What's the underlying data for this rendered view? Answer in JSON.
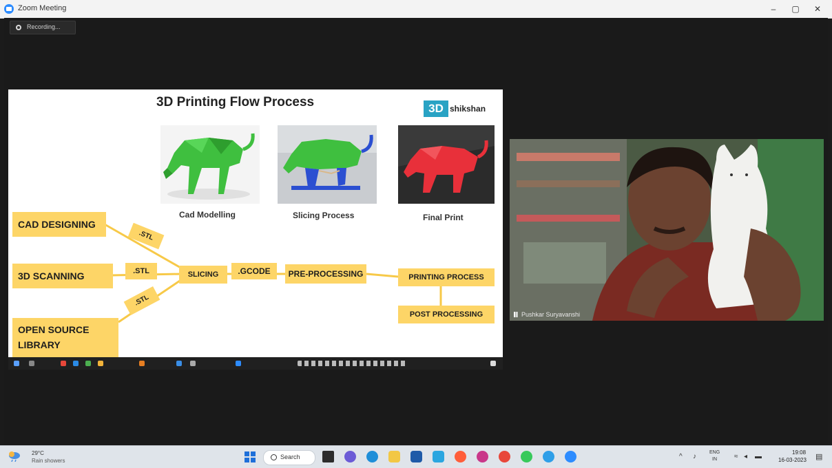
{
  "window": {
    "title": "Zoom Meeting",
    "minimize": "–",
    "restore": "▢",
    "close": "✕"
  },
  "recording": {
    "label": "Recording..."
  },
  "slide": {
    "title": "3D Printing Flow Process",
    "brand_3d": "3D",
    "brand_text": "shikshan",
    "captions": {
      "cad": "Cad Modelling",
      "slicing": "Slicing Process",
      "final": "Final Print"
    },
    "boxes": {
      "cad_designing": "CAD DESIGNING",
      "scanning": "3D SCANNING",
      "open_source": "OPEN SOURCE LIBRARY",
      "slicing": "SLICING",
      "gcode": ".GCODE",
      "pre_processing": "PRE-PROCESSING",
      "printing": "PRINTING PROCESS",
      "post": "POST PROCESSING"
    },
    "stl_labels": {
      "top": ".STL",
      "mid": ".STL",
      "bottom": ".STL"
    }
  },
  "participant": {
    "name": "Pushkar Suryavanshi"
  },
  "taskbar": {
    "weather_temp": "29°C",
    "weather_desc": "Rain showers",
    "search": "Search",
    "lang": "ENG",
    "region": "IN",
    "time": "19:08",
    "date": "16-03-2023"
  },
  "colors": {
    "box_yellow": "#fdd567",
    "cad_green": "#3fbf3f",
    "slice_blue": "#2b4fd1",
    "print_red": "#e8303a",
    "brand_blue": "#29a3c4"
  }
}
